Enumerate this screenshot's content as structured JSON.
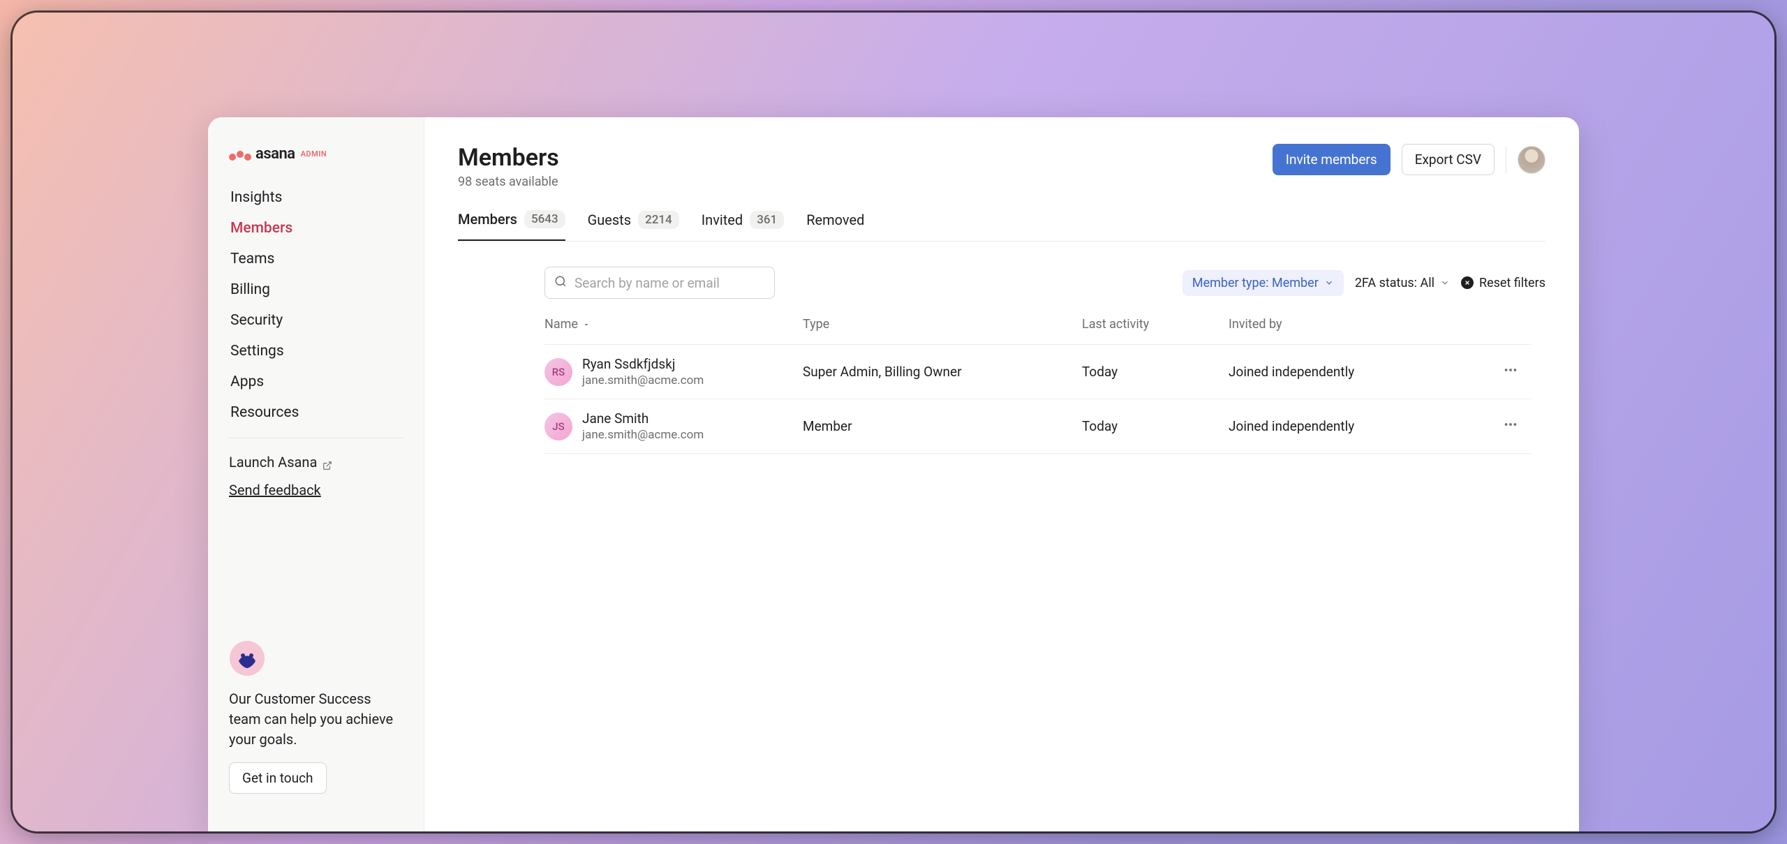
{
  "logo": {
    "brand": "asana",
    "suffix": "ADMIN"
  },
  "sidebar": {
    "items": [
      {
        "label": "Insights"
      },
      {
        "label": "Members"
      },
      {
        "label": "Teams"
      },
      {
        "label": "Billing"
      },
      {
        "label": "Security"
      },
      {
        "label": "Settings"
      },
      {
        "label": "Apps"
      },
      {
        "label": "Resources"
      }
    ],
    "launch": "Launch Asana",
    "feedback": "Send feedback",
    "promo_text": "Our Customer Success team can help you achieve your goals.",
    "promo_cta": "Get in touch"
  },
  "header": {
    "title": "Members",
    "subtitle": "98 seats available",
    "invite": "Invite members",
    "export": "Export CSV"
  },
  "tabs": [
    {
      "label": "Members",
      "count": "5643"
    },
    {
      "label": "Guests",
      "count": "2214"
    },
    {
      "label": "Invited",
      "count": "361"
    },
    {
      "label": "Removed",
      "count": ""
    }
  ],
  "toolbar": {
    "search_placeholder": "Search by name or email",
    "filter_member_type": "Member type: Member",
    "filter_2fa": "2FA status: All",
    "reset": "Reset filters"
  },
  "columns": {
    "name": "Name",
    "type": "Type",
    "last_activity": "Last activity",
    "invited_by": "Invited by"
  },
  "rows": [
    {
      "initials": "RS",
      "name": "Ryan Ssdkfjdskj",
      "email": "jane.smith@acme.com",
      "type": "Super Admin, Billing Owner",
      "last_activity": "Today",
      "invited_by": "Joined independently"
    },
    {
      "initials": "JS",
      "name": "Jane Smith",
      "email": "jane.smith@acme.com",
      "type": "Member",
      "last_activity": "Today",
      "invited_by": "Joined independently"
    }
  ]
}
